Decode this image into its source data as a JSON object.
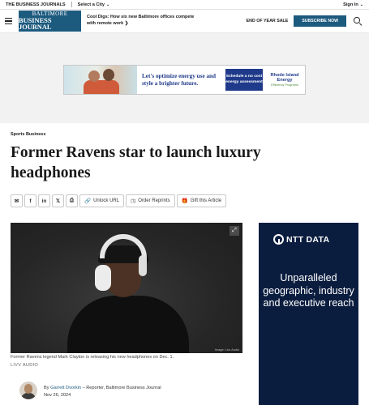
{
  "topbar": {
    "network": "THE BUSINESS JOURNALS",
    "select_city": "Select a City",
    "sign_in": "Sign In"
  },
  "header": {
    "logo_line1": "BALTIMORE",
    "logo_line2": "BUSINESS JOURNAL",
    "teaser": "Cool Digs: How six new Baltimore offices compete with remote work",
    "end_of_year": "END OF YEAR SALE",
    "subscribe": "SUBSCRIBE NOW"
  },
  "ad": {
    "headline": "Let's optimize energy use and style a brighter future.",
    "cta": "Schedule a no cost energy assessment",
    "brand_name": "Rhode Island Energy",
    "brand_sub": "Efficiency Programs"
  },
  "article": {
    "section": "Sports Business",
    "headline": "Former Ravens star to launch luxury headphones",
    "image_credit": "Image: Livv Audio",
    "caption": "Former Ravens legend Mark Clayton is releasing his new headphones on Dec. 1.",
    "photo_credit": "LIVV AUDIO",
    "by": "By",
    "author": "Garrett Dvorkin",
    "role": " – Reporter, Baltimore Business Journal",
    "date": "Nov 26, 2024"
  },
  "actions": {
    "unlock": "Unlock URL",
    "reprints": "Order Reprints",
    "gift": "Gift this Article"
  },
  "side_ad": {
    "brand": "NTT DATA",
    "text": "Unparalleled geographic, industry and executive reach"
  }
}
